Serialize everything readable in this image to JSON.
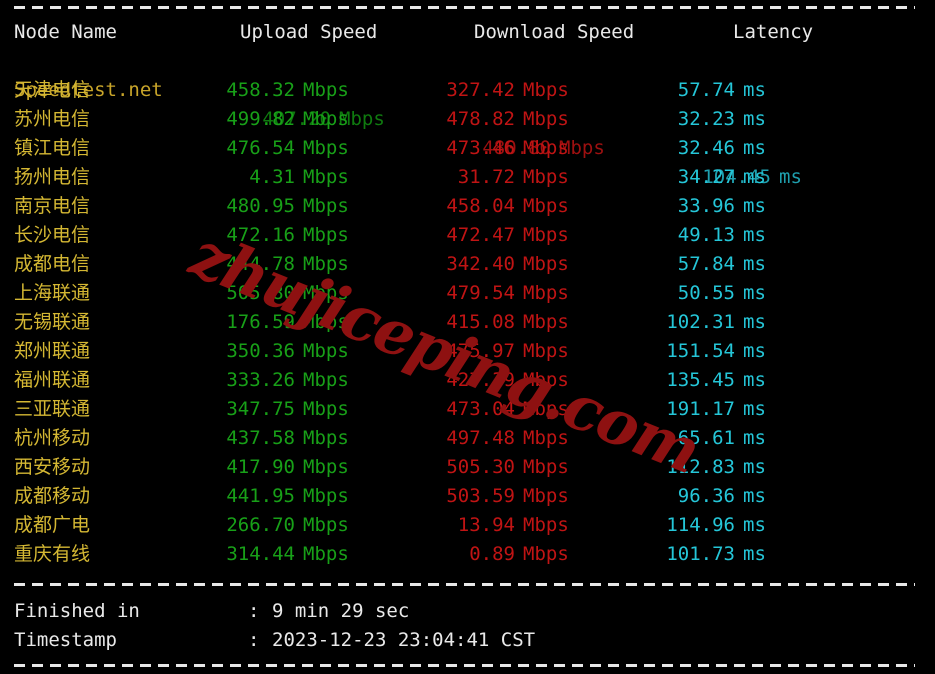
{
  "header": {
    "node": "Node Name",
    "upload": "Upload Speed",
    "download": "Download Speed",
    "latency": "Latency"
  },
  "units": {
    "speed": "Mbps",
    "latency": "ms"
  },
  "colors": {
    "background": "#000000",
    "header_text": "#e9e9e9",
    "node_name": "#d4b733",
    "upload": "#18a018",
    "download": "#c01414",
    "latency": "#25c6d8",
    "rule": "#e8e8e8",
    "watermark": "#8e1111"
  },
  "reference_row": {
    "node": "Speedtest.net",
    "upload": "407.20",
    "upload_unit": "Mbps",
    "download": "480.80",
    "download_unit": "Mbps",
    "latency": "104.45",
    "latency_unit": "ms"
  },
  "rows": [
    {
      "node": "天津电信",
      "upload": "458.32",
      "download": "327.42",
      "latency": "57.74"
    },
    {
      "node": "苏州电信",
      "upload": "499.82",
      "download": "478.82",
      "latency": "32.23"
    },
    {
      "node": "镇江电信",
      "upload": "476.54",
      "download": "473.46",
      "latency": "32.46"
    },
    {
      "node": "扬州电信",
      "upload": "4.31",
      "download": "31.72",
      "latency": "34.27"
    },
    {
      "node": "南京电信",
      "upload": "480.95",
      "download": "458.04",
      "latency": "33.96"
    },
    {
      "node": "长沙电信",
      "upload": "472.16",
      "download": "472.47",
      "latency": "49.13"
    },
    {
      "node": "成都电信",
      "upload": "444.78",
      "download": "342.40",
      "latency": "57.84"
    },
    {
      "node": "上海联通",
      "upload": "505.80",
      "download": "479.54",
      "latency": "50.55"
    },
    {
      "node": "无锡联通",
      "upload": "176.59",
      "download": "415.08",
      "latency": "102.31"
    },
    {
      "node": "郑州联通",
      "upload": "350.36",
      "download": "475.97",
      "latency": "151.54"
    },
    {
      "node": "福州联通",
      "upload": "333.26",
      "download": "427.39",
      "latency": "135.45"
    },
    {
      "node": "三亚联通",
      "upload": "347.75",
      "download": "473.04",
      "latency": "191.17"
    },
    {
      "node": "杭州移动",
      "upload": "437.58",
      "download": "497.48",
      "latency": "65.61"
    },
    {
      "node": "西安移动",
      "upload": "417.90",
      "download": "505.30",
      "latency": "112.83"
    },
    {
      "node": "成都移动",
      "upload": "441.95",
      "download": "503.59",
      "latency": "96.36"
    },
    {
      "node": "成都广电",
      "upload": "266.70",
      "download": "13.94",
      "latency": "114.96"
    },
    {
      "node": "重庆有线",
      "upload": "314.44",
      "download": "0.89",
      "latency": "101.73"
    }
  ],
  "footer": {
    "finished_label": "Finished in",
    "finished_separator": ":",
    "finished_value": "9 min 29 sec",
    "timestamp_label": "Timestamp",
    "timestamp_separator": ":",
    "timestamp_value": "2023-12-23 23:04:41 CST"
  },
  "watermark": {
    "text": "zhujiceping.com"
  }
}
